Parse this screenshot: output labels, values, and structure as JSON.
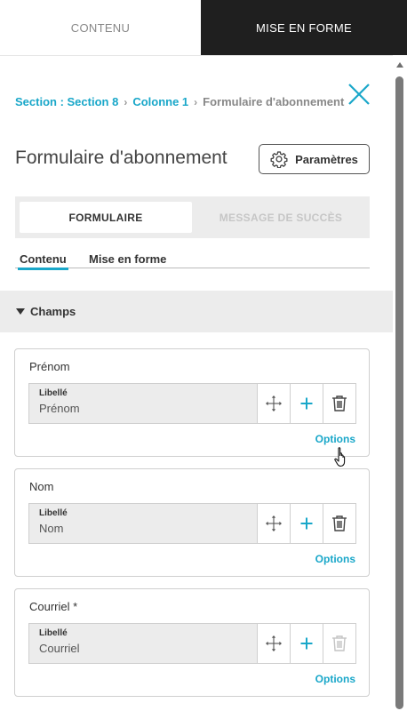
{
  "top_tabs": [
    {
      "label": "CONTENU",
      "active": false
    },
    {
      "label": "MISE EN FORME",
      "active": true
    }
  ],
  "breadcrumb": {
    "items": [
      "Section : Section 8",
      "Colonne 1"
    ],
    "current": "Formulaire d'abonnement"
  },
  "title": "Formulaire d'abonnement",
  "params_button": "Paramètres",
  "segment_tabs": [
    "FORMULAIRE",
    "MESSAGE DE SUCCÈS"
  ],
  "sub_tabs": [
    "Contenu",
    "Mise en forme"
  ],
  "section": {
    "label": "Champs",
    "expanded": true
  },
  "fields": [
    {
      "title": "Prénom",
      "label_caption": "Libellé",
      "value": "Prénom",
      "options": "Options",
      "delete_enabled": true
    },
    {
      "title": "Nom",
      "label_caption": "Libellé",
      "value": "Nom",
      "options": "Options",
      "delete_enabled": true
    },
    {
      "title": "Courriel *",
      "label_caption": "Libellé",
      "value": "Courriel",
      "options": "Options",
      "delete_enabled": false
    }
  ],
  "colors": {
    "accent": "#19a7c9",
    "dark_tab": "#1f1f1f",
    "panel_gray": "#ececec",
    "disabled_icon": "#c4c4c4"
  },
  "icons": {
    "close": "close-icon",
    "settings": "gear-icon",
    "move": "move-arrows-icon",
    "add": "plus-icon",
    "delete": "trash-icon",
    "collapse": "triangle-down-icon"
  }
}
